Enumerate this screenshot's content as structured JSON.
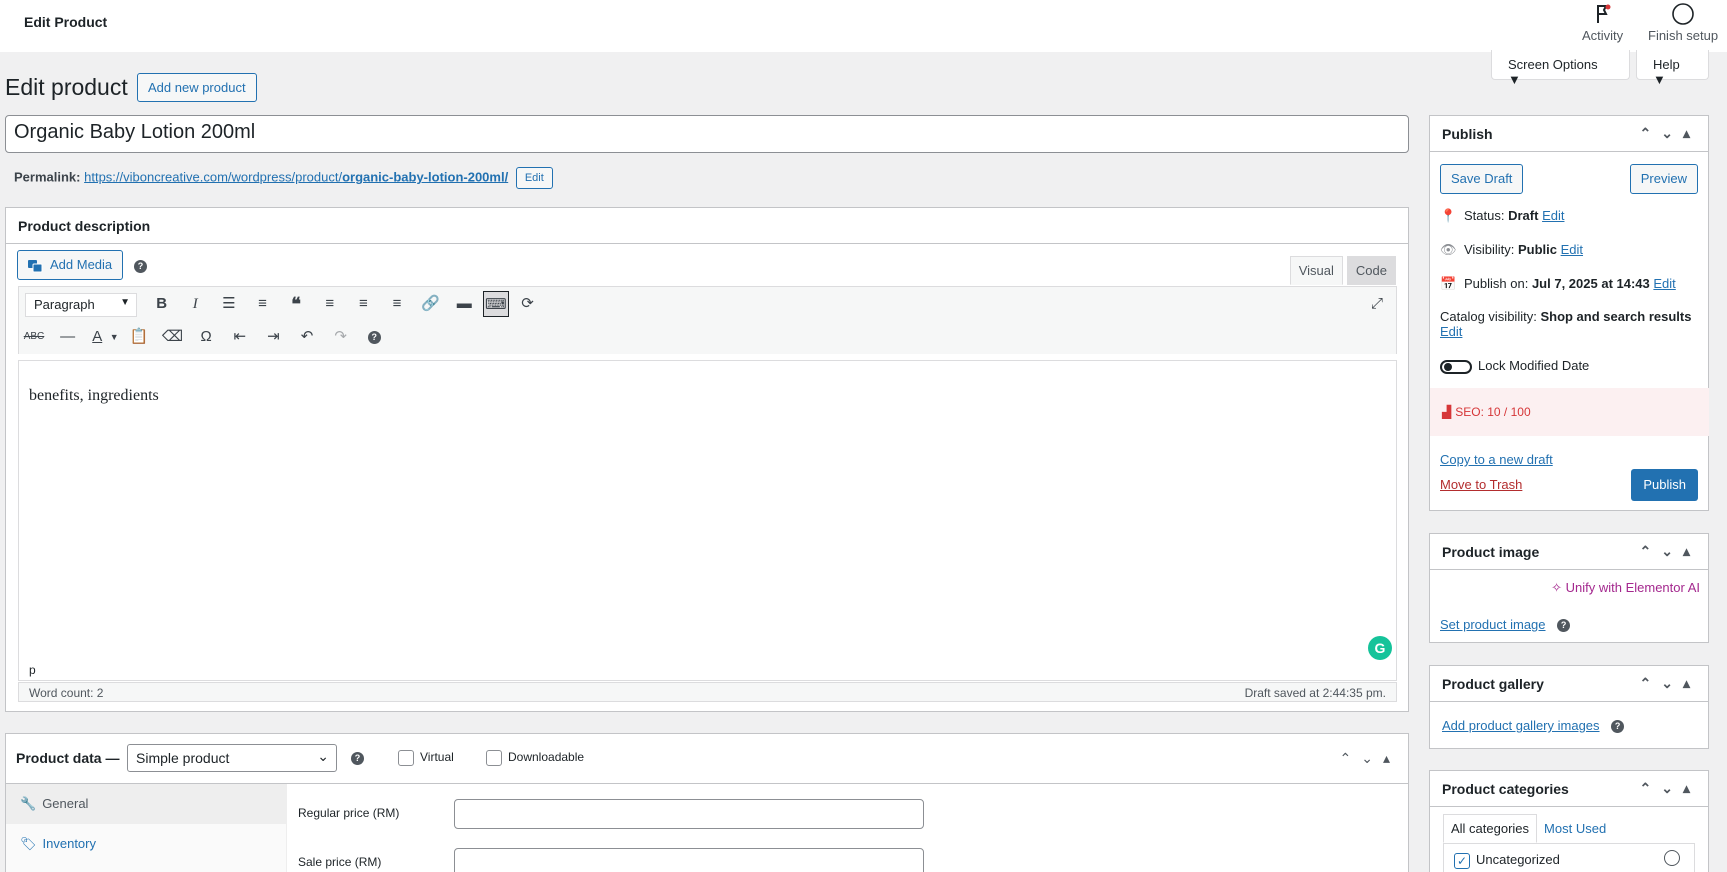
{
  "topbar": {
    "page_label": "Edit Product",
    "activity_label": "Activity",
    "finish_setup_label": "Finish setup"
  },
  "screen_options": {
    "label": "Screen Options ▼",
    "help_label": "Help ▼"
  },
  "header": {
    "title": "Edit product",
    "add_new_label": "Add new product"
  },
  "product": {
    "title": "Organic Baby Lotion 200ml",
    "permalink_label": "Permalink:",
    "permalink_base": "https://viboncreative.com/wordpress/product/",
    "permalink_slug": "organic-baby-lotion-200ml/",
    "permalink_edit": "Edit"
  },
  "description": {
    "heading": "Product description",
    "add_media": "Add Media",
    "tab_visual": "Visual",
    "tab_code": "Code",
    "format_select": "Paragraph",
    "content": "benefits, ingredients",
    "path": "p",
    "word_count": "Word count: 2",
    "draft_saved": "Draft saved at 2:44:35 pm."
  },
  "product_data": {
    "heading": "Product data —",
    "type_select": "Simple product",
    "virtual_label": "Virtual",
    "downloadable_label": "Downloadable",
    "tabs": [
      {
        "label": "General"
      },
      {
        "label": "Inventory"
      }
    ],
    "regular_price_label": "Regular price (RM)",
    "sale_price_label": "Sale price (RM)"
  },
  "publish": {
    "heading": "Publish",
    "save_draft": "Save Draft",
    "preview": "Preview",
    "status_label": "Status:",
    "status_value": "Draft",
    "visibility_label": "Visibility:",
    "visibility_value": "Public",
    "publish_on_label": "Publish on:",
    "publish_on_value": "Jul 7, 2025 at 14:43",
    "catalog_label": "Catalog visibility:",
    "catalog_value": "Shop and search results",
    "edit_link": "Edit",
    "lock_modified": "Lock Modified Date",
    "seo": "SEO: 10 / 100",
    "copy_draft": "Copy to a new draft",
    "move_trash": "Move to Trash",
    "publish_button": "Publish"
  },
  "product_image": {
    "heading": "Product image",
    "elementor": "Unify with Elementor AI",
    "set_image": "Set product image"
  },
  "product_gallery": {
    "heading": "Product gallery",
    "add_images": "Add product gallery images"
  },
  "product_categories": {
    "heading": "Product categories",
    "tab_all": "All categories",
    "tab_most_used": "Most Used",
    "items": [
      {
        "label": "Uncategorized"
      }
    ]
  },
  "colors": {
    "accent": "#2271b1",
    "seo_red": "#d63638",
    "elementor": "#a4288e"
  }
}
